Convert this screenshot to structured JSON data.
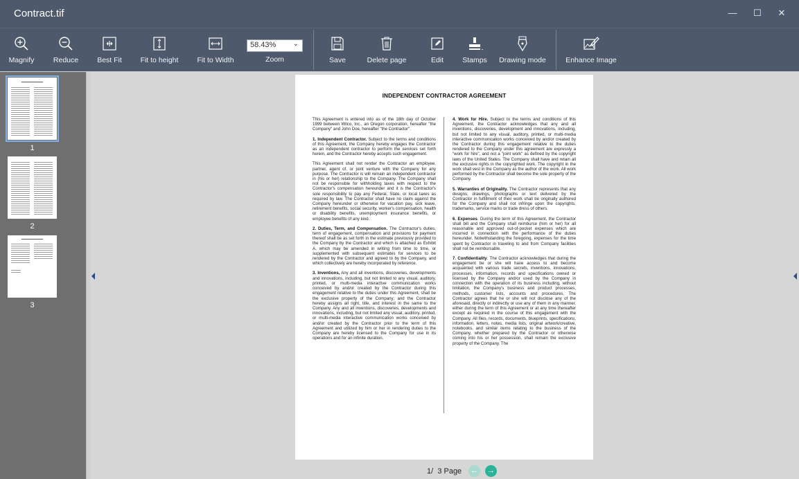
{
  "window": {
    "title": "Contract.tif",
    "controls": {
      "minimize": "—",
      "maximize": "☐",
      "close": "✕"
    }
  },
  "toolbar": {
    "magnify": "Magnify",
    "reduce": "Reduce",
    "best_fit": "Best Fit",
    "fit_height": "Fit to height",
    "fit_width": "Fit to Width",
    "zoom_value": "58.43%",
    "zoom_label": "Zoom",
    "save": "Save",
    "delete_page": "Delete page",
    "edit": "Edit",
    "stamps": "Stamps",
    "drawing_mode": "Drawing mode",
    "enhance_image": "Enhance Image"
  },
  "thumbnails": [
    {
      "number": "1",
      "selected": true
    },
    {
      "number": "2",
      "selected": false
    },
    {
      "number": "3",
      "selected": false
    }
  ],
  "document": {
    "title": "INDEPENDENT CONTRACTOR AGREEMENT",
    "left": {
      "p1": "This Agreement is entered into as of the 18th day of October 1999 between Wilco, Inc., an Oregon corporation, hereafter \"the Company\" and John Doe, hereafter \"the Contractor\".",
      "p2_head": "1. Independent Contractor.",
      "p2": " Subject to the terms and conditions of this Agreement, the Company hereby engages the Contractor as an independent contractor to perform the services set forth herein, and the Contractor hereby accepts such engagement.",
      "p3": "This Agreement shall not render the Contractor an employee, partner, agent of, or joint venture with the Company for any purpose. The Contractor is will remain an independent contractor in (his or her) relationship to the Company. The Company shall not be responsible for withholding taxes with respect to the Contractor's compensation hereunder and it is the Contractor's sole responsibility to pay any Federal, State, or local taxes as required by law. The Contractor shall have no claim against the Company hereunder or otherwise for vacation pay, sick leave, retirement benefits, social security, worker's compensation, health or disability benefits, unemployment insurance benefits, or employee benefits of any kind.",
      "p4_head": "2. Duties, Term, and Compensation.",
      "p4": " The Contractor's duties, term of engagement, compensation and provisions for payment thereof shall be as set forth in the estimate previously provided to the Company by the Contractor and which is attached as Exhibit A, which may be amended in writing from time to time, or supplemented with subsequent estimates for services to be rendered by the Contractor and agreed to by the Company, and which collectively are hereby incorporated by reference.",
      "p5_head": "3. Inventions,",
      "p5": " Any and all inventions, discoveries, developments and innovations, including, but not limited to any visual, auditory, printed, or multi-media interactive communication works conceived by and/or created by the Contractor during this engagement relative to the duties under this Agreement, shall be the exclusive property of the Company; and the Contractor hereby assigns all right, title, and interest in the same to the Company. Any and all inventions, discoveries, developments and innovations, including, but not limited any visual, auditory, printed, or multi-media interactive communication works conceived by and/or created by the Contractor prior to the term of this Agreement and utilized by him or her in rendering duties to the Company are hereby licensed to the Company for use in its operations and for an infinite duration."
    },
    "right": {
      "p1_head": "4. Work for Hire.",
      "p1": " Subject to the terms and conditions of this Agreement, the Contractor acknowledges that any and all inventions, discoveries, development and innovations, including, but not limited to any visual, auditory, printed, or multi-media interactive communication works conceived by and/or created by the Contractor during this engagement relative to the duties rendered to the Company under this agreement are expressly a \"work for hire\", and not a \"joint work\" as defined by the copyright laws of the United States. The Company shall have and retain all the exclusive rights in the copyrighted work. The copyright in the work shall vest in the Company as the author of the work. All work performed by the Contractor shall become the sole property of the Company.",
      "p2_head": "5. Warranties of Originality.",
      "p2": " The Contractor represents that any designs, drawings, photographs or text delivered by the Contractor in fulfillment of their work shall be originally authored for the Company and shall not infringe upon the copyrights, trademarks, service marks or trade dress of others.",
      "p3_head": "6. Expenses",
      "p3": ". During the term of this Agreement, the Contractor shall bill and the Company shall reimburse (him or her) for all reasonable and approved out-of-pocket expenses which are incurred in connection with the performance of the duties hereunder. Notwithstanding the foregoing, expenses for the time spent by Contractor in traveling to and from Company facilities shall not be reimbursable.",
      "p4_head": "7. Confidentiality",
      "p4": ". The Contractor acknowledges that during the engagement be or she will have access to and become acquainted with various trade secrets, inventions, innovations, processes, information, records and specifications owned or licensed by the Company and/or used by the Company in connection with the operation of its business including, without limitation, the Company's business and product processes, methods, customer lists, accounts and procedures. The Contractor agrees that he or she will not disclose any of the aforesaid, directly or indirectly or use any of them in any manner, either during the term of this Agreement or at any time thereafter except as required in the course of this engagement with the Company. All files, records, documents, blueprints, specifications, information, letters, notes, media lists, original artwork/creative, notebooks, and similar items relating to the business of the Company, whether prepared by the Contractor or otherwise coming into his or her possession, shall remain the exclusive property of the Company. The"
    }
  },
  "pager": {
    "current": "1/",
    "total": "3 Page",
    "prev_color": "#a9d9cf",
    "next_color": "#2bb39a"
  }
}
